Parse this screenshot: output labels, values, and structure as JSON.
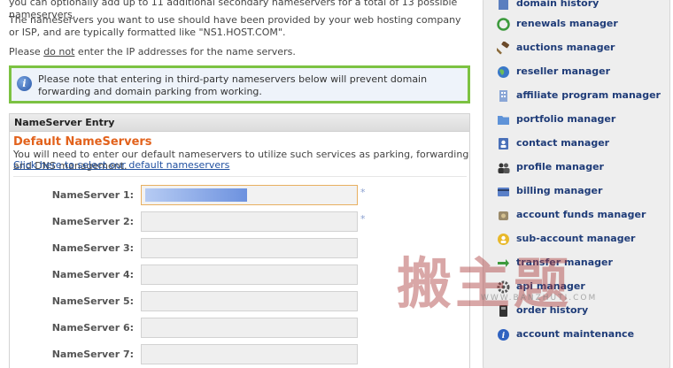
{
  "intro": {
    "line1": "you can optionally add up to 11 additional secondary nameservers for a total of 13 possible nameservers.",
    "line2": "The nameservers you want to use should have been provided by your web hosting company or ISP, and are typically formatted like \"NS1.HOST.COM\".",
    "line3_pre": "Please ",
    "line3_u": "do not",
    "line3_post": " enter the IP addresses for the name servers."
  },
  "notice": {
    "text": "Please note that entering in third-party nameservers below will prevent domain forwarding and domain parking from working."
  },
  "panel": {
    "header": "NameServer Entry",
    "title": "Default NameServers",
    "description": "You will need to enter our default nameservers to utilize such services as parking, forwarding and DNS management.",
    "link": "Click here to select our default nameservers",
    "required_mark": "*",
    "rows": [
      {
        "label": "NameServer 1:",
        "value": "",
        "required": true
      },
      {
        "label": "NameServer 2:",
        "value": "",
        "required": true
      },
      {
        "label": "NameServer 3:",
        "value": "",
        "required": false
      },
      {
        "label": "NameServer 4:",
        "value": "",
        "required": false
      },
      {
        "label": "NameServer 5:",
        "value": "",
        "required": false
      },
      {
        "label": "NameServer 6:",
        "value": "",
        "required": false
      },
      {
        "label": "NameServer 7:",
        "value": "",
        "required": false
      }
    ]
  },
  "sidebar": {
    "items": [
      {
        "label": "domain history",
        "icon": "history-icon"
      },
      {
        "label": "renewals manager",
        "icon": "renewals-icon"
      },
      {
        "label": "auctions manager",
        "icon": "gavel-icon"
      },
      {
        "label": "reseller manager",
        "icon": "globe-icon"
      },
      {
        "label": "affiliate program manager",
        "icon": "building-icon"
      },
      {
        "label": "portfolio manager",
        "icon": "folder-icon"
      },
      {
        "label": "contact manager",
        "icon": "contact-icon"
      },
      {
        "label": "profile manager",
        "icon": "users-icon"
      },
      {
        "label": "billing manager",
        "icon": "billing-icon"
      },
      {
        "label": "account funds manager",
        "icon": "funds-icon"
      },
      {
        "label": "sub-account manager",
        "icon": "sub-account-icon"
      },
      {
        "label": "transfer manager",
        "icon": "transfer-icon"
      },
      {
        "label": "api manager",
        "icon": "gear-icon"
      },
      {
        "label": "order history",
        "icon": "order-icon"
      },
      {
        "label": "account maintenance",
        "icon": "info-icon"
      }
    ]
  },
  "watermark": {
    "big": "搬主题",
    "small": "WWW.BANZHUTI.COM"
  },
  "colors": {
    "notice_border": "#7cc242",
    "title_orange": "#e2621c",
    "link_blue": "#2050a0",
    "sidebar_text": "#1f3c78"
  }
}
